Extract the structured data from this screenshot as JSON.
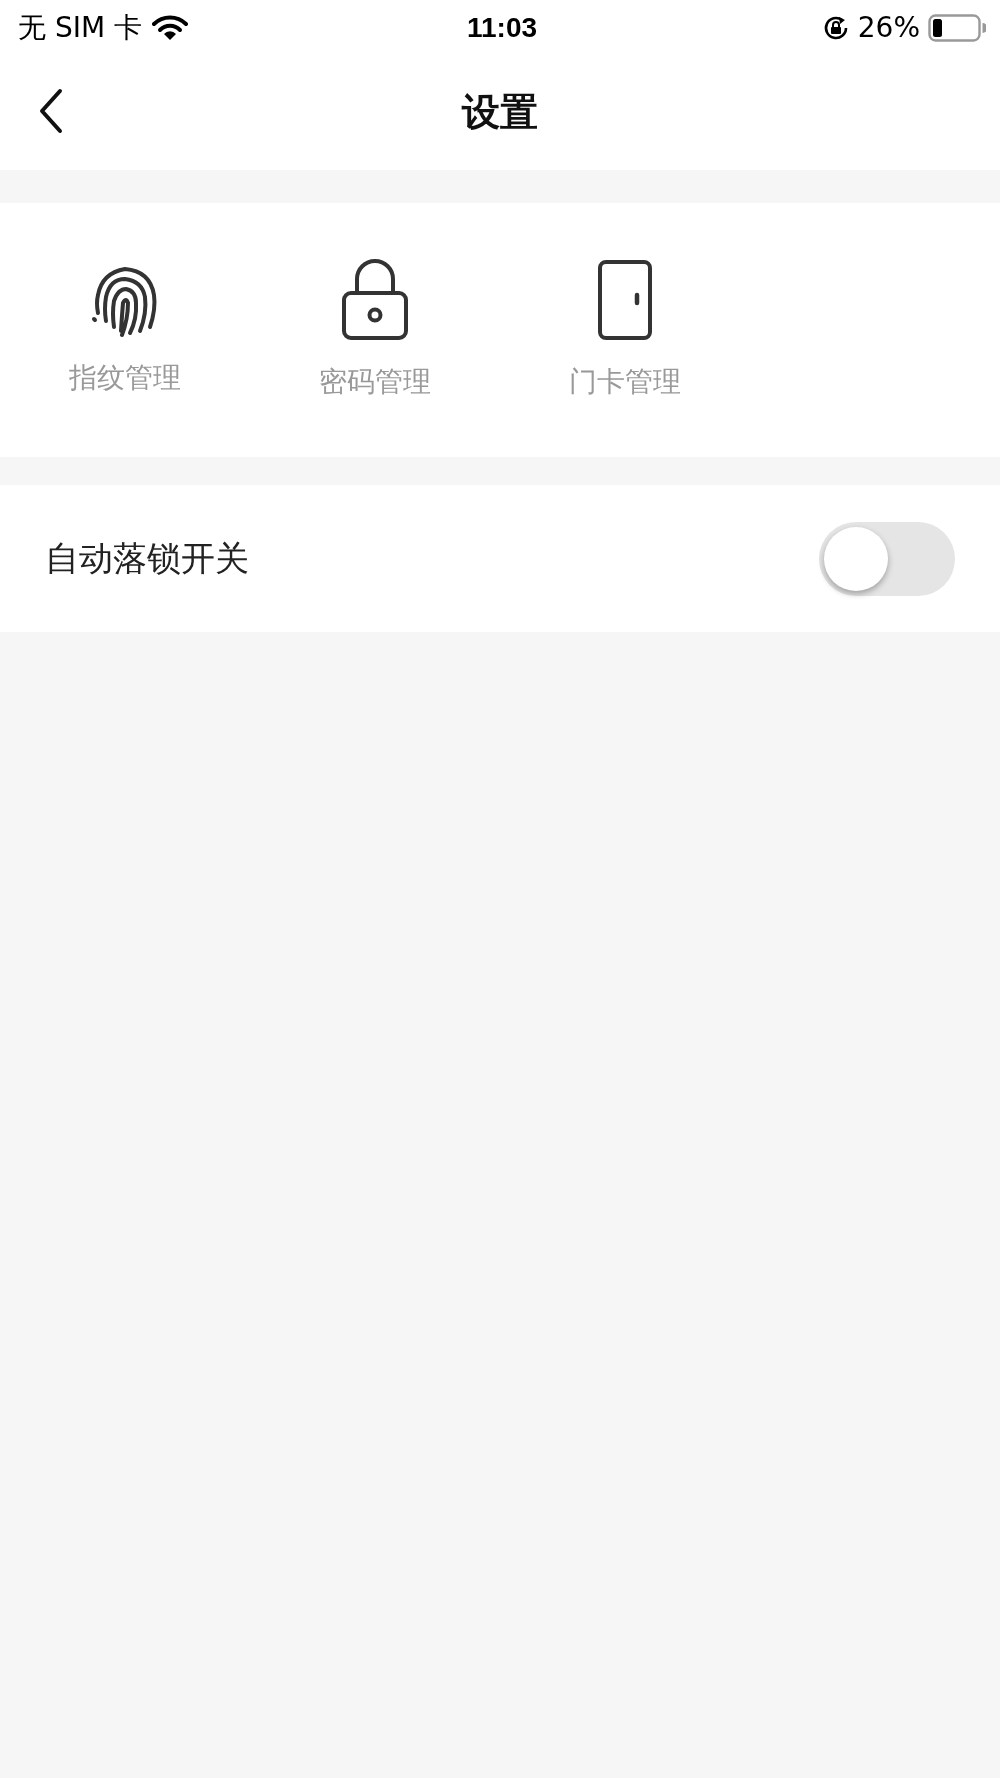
{
  "status_bar": {
    "carrier": "无 SIM 卡",
    "time": "11:03",
    "battery": "26%"
  },
  "nav": {
    "title": "设置"
  },
  "shortcuts": [
    {
      "kind": "fingerprint",
      "label": "指纹管理"
    },
    {
      "kind": "lock",
      "label": "密码管理"
    },
    {
      "kind": "door",
      "label": "门卡管理"
    }
  ],
  "settings": [
    {
      "label": "自动落锁开关",
      "on": false
    }
  ]
}
